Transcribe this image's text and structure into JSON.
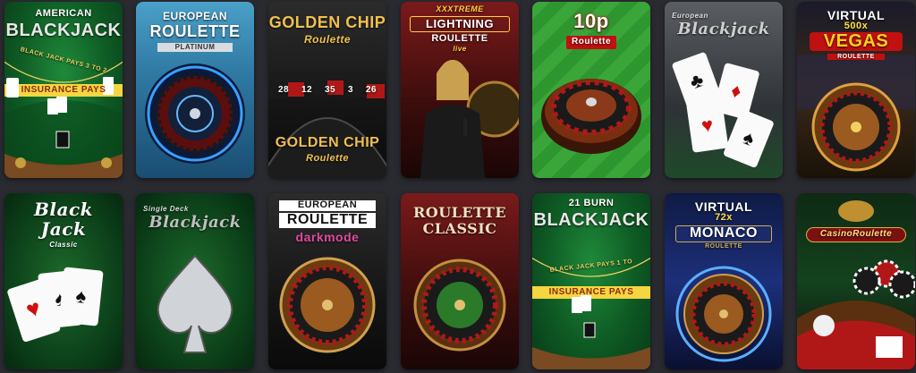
{
  "tiles": [
    {
      "title": "AMERICAN",
      "subtitle": "BLACKJACK",
      "note": "BLACK JACK PAYS 3 TO 2",
      "extra": "INSURANCE PAYS"
    },
    {
      "title": "EUROPEAN",
      "subtitle": "ROULETTE",
      "extra": "PLATINUM"
    },
    {
      "title": "GOLDEN CHIP",
      "subtitle": "Roulette",
      "extra": "GOLDEN CHIP",
      "extra2": "Roulette",
      "numbers": [
        "28",
        "12",
        "35",
        "3",
        "26"
      ]
    },
    {
      "title": "XXXTREME",
      "subtitle": "LIGHTNING",
      "extra": "ROULETTE",
      "extra2": "live"
    },
    {
      "title": "10p",
      "subtitle": "Roulette"
    },
    {
      "title": "European",
      "subtitle": "Blackjack"
    },
    {
      "title": "VIRTUAL",
      "subtitle": "500x",
      "extra": "VEGAS",
      "extra2": "ROULETTE"
    },
    {
      "title": "Black",
      "subtitle": "Jack",
      "extra": "Classic"
    },
    {
      "title": "Single Deck",
      "subtitle": "Blackjack"
    },
    {
      "title": "EUROPEAN",
      "subtitle": "ROULETTE",
      "extra": "darkmode"
    },
    {
      "title": "ROULETTE",
      "subtitle": "CLASSIC"
    },
    {
      "title": "21 BURN",
      "subtitle": "BLACKJACK",
      "note": "BLACK JACK PAYS 1 TO",
      "extra": "INSURANCE PAYS"
    },
    {
      "title": "VIRTUAL",
      "subtitle": "72x",
      "extra": "MONACO",
      "extra2": "ROULETTE"
    },
    {
      "title": "CasinoRoulette"
    }
  ]
}
